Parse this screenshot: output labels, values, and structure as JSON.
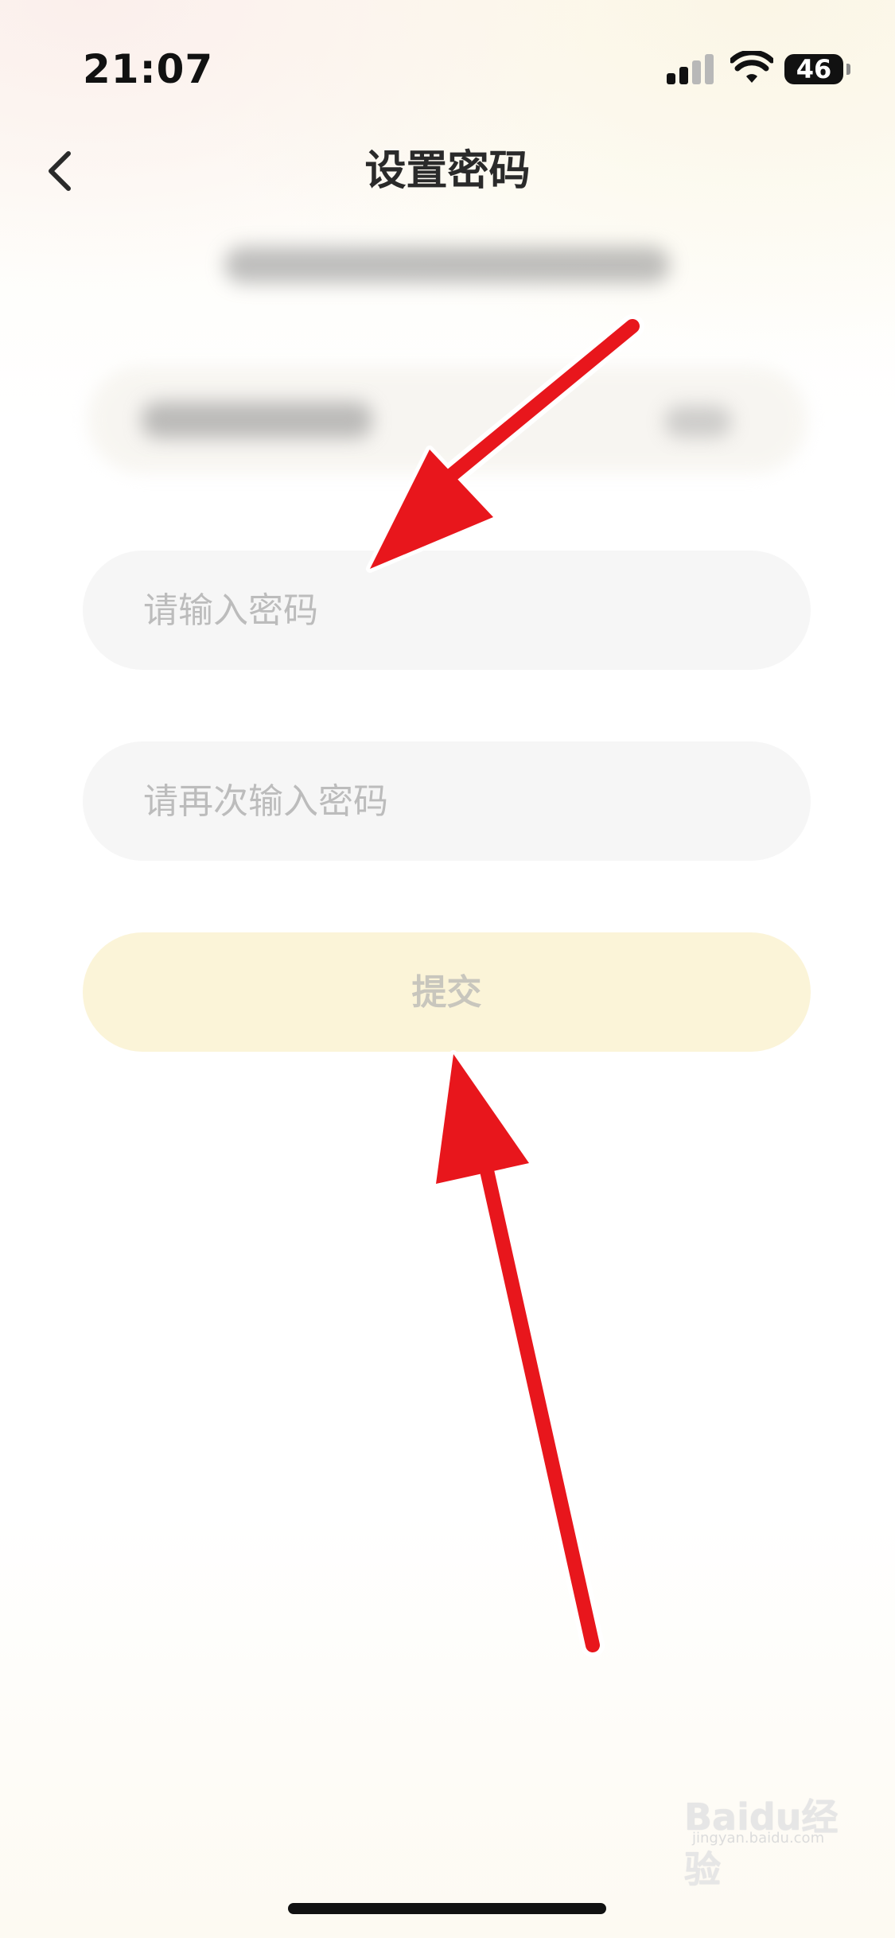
{
  "status_bar": {
    "time": "21:07",
    "battery": "46",
    "icons": [
      "cellular-signal-icon",
      "wifi-icon",
      "battery-icon"
    ]
  },
  "nav": {
    "back_icon": "chevron-left-icon",
    "title": "设置密码"
  },
  "form": {
    "password_placeholder": "请输入密码",
    "confirm_placeholder": "请再次输入密码",
    "submit_label": "提交"
  },
  "watermark": {
    "brand": "Baidu经验",
    "url": "jingyan.baidu.com"
  },
  "colors": {
    "annotation_arrow": "#e8161c",
    "submit_bg": "#fbf4d8",
    "field_bg": "#f6f6f6"
  }
}
